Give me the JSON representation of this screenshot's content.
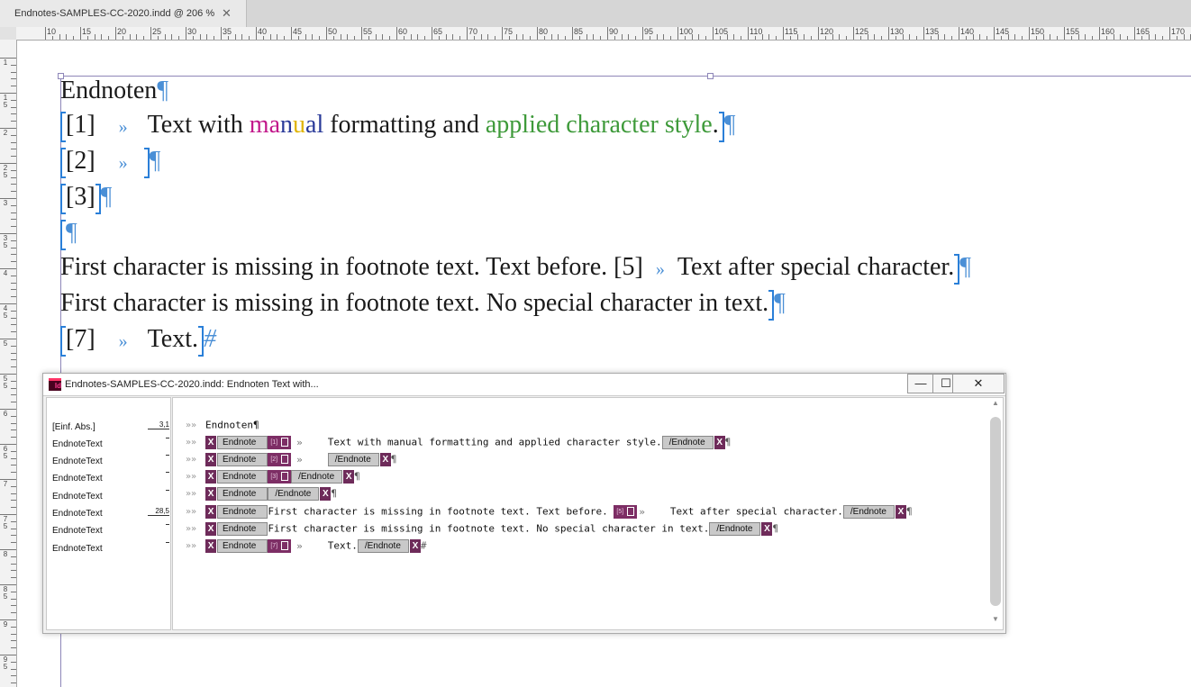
{
  "tab": {
    "title": "Endnotes-SAMPLES-CC-2020.indd @ 206 %",
    "close": "✕"
  },
  "ruler": {
    "h_labels": [
      "10",
      "15",
      "20",
      "25",
      "30",
      "35",
      "40",
      "45",
      "50",
      "55",
      "60",
      "65",
      "70",
      "75",
      "80",
      "85",
      "90",
      "95",
      "100",
      "105",
      "110",
      "115",
      "120",
      "125",
      "130",
      "135",
      "140",
      "145",
      "150",
      "155",
      "160",
      "165",
      "170"
    ],
    "v_labels": [
      "1",
      "1 5",
      "2",
      "2 5",
      "3",
      "3 5",
      "4",
      "4 5",
      "5",
      "5 5",
      "6",
      "6 5",
      "7",
      "7 5",
      "8",
      "8 5",
      "9",
      "9 5"
    ]
  },
  "document": {
    "heading": "Endnoten",
    "pilcrow": "¶",
    "raquo": "»",
    "hash": "#",
    "line1": {
      "num": "[1]",
      "pre": "Text with ",
      "manual_m": "m",
      "manual_a": "a",
      "manual_n": "n",
      "manual_u": "u",
      "manual_a2": "a",
      "manual_l": "l",
      "mid": " formatting and ",
      "styled": "applied character style",
      "end": "."
    },
    "line2": {
      "num": "[2]"
    },
    "line3": {
      "num": "[3]"
    },
    "line5": {
      "a": "First character is missing in footnote text. Text before. ",
      "num": "[5]",
      "b": "Text after special character."
    },
    "line6": {
      "text": "First character is missing in footnote text. No special character in text."
    },
    "line7": {
      "num": "[7]",
      "text": "Text."
    }
  },
  "editor": {
    "title": "Endnotes-SAMPLES-CC-2020.indd: Endnoten   Text with...",
    "buttons": {
      "minimize": "—",
      "maximize": "☐",
      "close": "✕"
    },
    "styles": [
      {
        "name": "[Einf. Abs.]",
        "depth": "3,1"
      },
      {
        "name": "EndnoteText",
        "depth": ""
      },
      {
        "name": "EndnoteText",
        "depth": ""
      },
      {
        "name": "EndnoteText",
        "depth": ""
      },
      {
        "name": "EndnoteText",
        "depth": ""
      },
      {
        "name": "EndnoteText",
        "depth": "28,5"
      },
      {
        "name": "EndnoteText",
        "depth": ""
      },
      {
        "name": "EndnoteText",
        "depth": ""
      }
    ],
    "fw": "»»",
    "tag_x": "X",
    "tag_name": "Endnote",
    "tag_close": "/Endnote",
    "row0": "Endnoten¶",
    "m1": "[1]",
    "m2": "[2]",
    "m3": "[3]",
    "m5": "[5]",
    "m7": "[7]",
    "raq": "»",
    "row1_text": "Text with manual formatting and applied character style.",
    "row5_a": "First character is missing in footnote text. Text before. ",
    "row5_b": "Text after special character.",
    "row6_text": "First character is missing in footnote text. No special character in text.",
    "row7_text": "Text.",
    "pilcrow": "¶",
    "hash": "#"
  },
  "colors": {
    "manual_magenta": "#c2188b",
    "manual_blue": "#2a3a99",
    "manual_yellow": "#e0b400",
    "char_style_green": "#3e9a3a",
    "tag_purple": "#7d2e65"
  }
}
